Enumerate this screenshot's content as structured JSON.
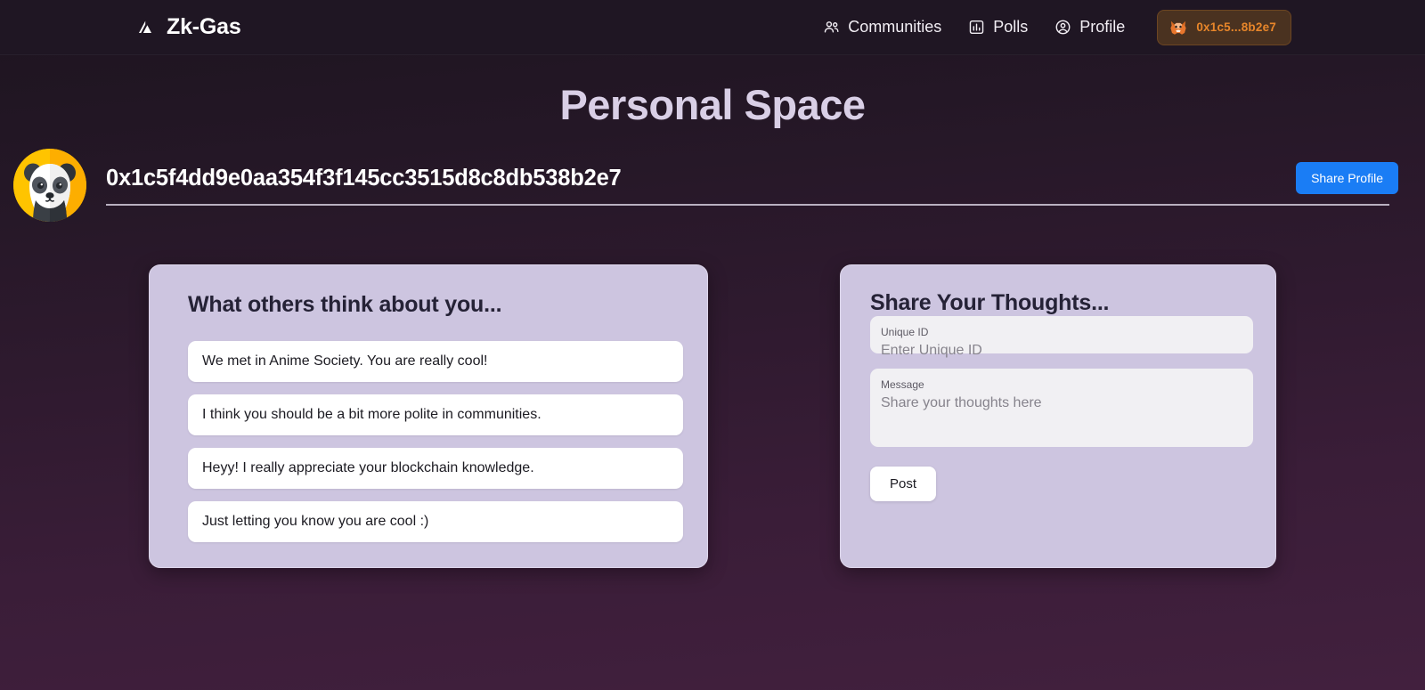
{
  "header": {
    "brand_icon": "triangle-logo-icon",
    "brand_name": "Zk-Gas",
    "nav": [
      {
        "label": "Communities",
        "icon": "users-icon"
      },
      {
        "label": "Polls",
        "icon": "chart-bar-icon"
      },
      {
        "label": "Profile",
        "icon": "user-circle-icon"
      }
    ],
    "wallet": {
      "icon": "metamask-fox-icon",
      "address_short": "0x1c5...8b2e7"
    }
  },
  "page": {
    "title": "Personal Space"
  },
  "profile": {
    "avatar_icon": "panda-avatar",
    "address": "0x1c5f4dd9e0aa354f3f145cc3515d8c8db538b2e7",
    "share_button_label": "Share Profile"
  },
  "messages_card": {
    "title": "What others think about you...",
    "items": [
      "We met in Anime Society. You are really cool!",
      "I think you should be a bit more polite in communities.",
      "Heyy! I really appreciate your blockchain knowledge.",
      "Just letting you know you are cool :)"
    ]
  },
  "compose_card": {
    "title": "Share Your Thoughts...",
    "unique_id": {
      "label": "Unique ID",
      "placeholder": "Enter Unique ID",
      "value": ""
    },
    "message": {
      "label": "Message",
      "placeholder": "Share your thoughts here",
      "value": ""
    },
    "post_button_label": "Post"
  },
  "colors": {
    "accent_blue": "#1a7df5",
    "wallet_orange": "#e8862a",
    "card_lavender": "#cdc5e0",
    "title_lavender": "#d9cfe6",
    "bg_dark": "#1d141f",
    "bg_plum": "#42203e"
  }
}
